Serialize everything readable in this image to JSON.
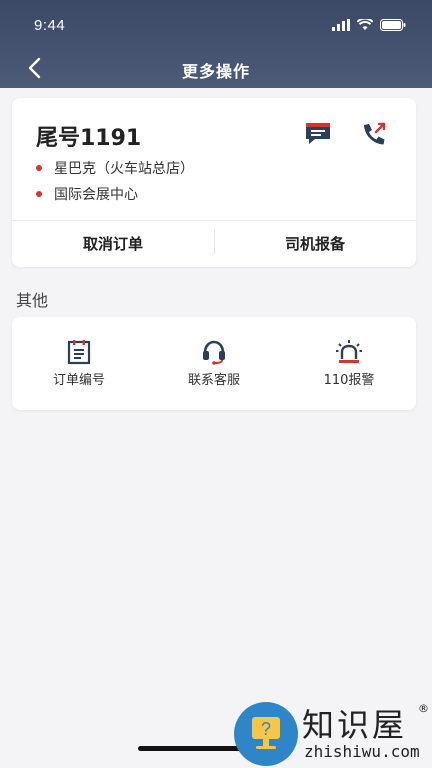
{
  "status_bar": {
    "time": "9:44"
  },
  "nav": {
    "title": "更多操作",
    "back_icon": "chevron-left-icon"
  },
  "order": {
    "tail_number": "尾号1191",
    "addresses": [
      {
        "text": "星巴克（火车站总店）"
      },
      {
        "text": "国际会展中心"
      }
    ],
    "actions": [
      {
        "icon": "message-icon",
        "color": "#d9342b"
      },
      {
        "icon": "phone-call-icon",
        "color": "#2c3e5e"
      }
    ],
    "buttons": {
      "cancel": "取消订单",
      "report": "司机报备"
    }
  },
  "section": {
    "other_label": "其他"
  },
  "tools": [
    {
      "label": "订单编号",
      "icon": "order-number-icon"
    },
    {
      "label": "联系客服",
      "icon": "headset-icon"
    },
    {
      "label": "110报警",
      "icon": "alarm-icon"
    }
  ],
  "watermark": {
    "brand": "知识屋",
    "url": "zhishiwu.com",
    "mark": "®"
  },
  "colors": {
    "header_bg": "#45526f",
    "accent_red": "#d9342b",
    "icon_navy": "#2c3e5e",
    "page_bg": "#f4f4f6"
  }
}
